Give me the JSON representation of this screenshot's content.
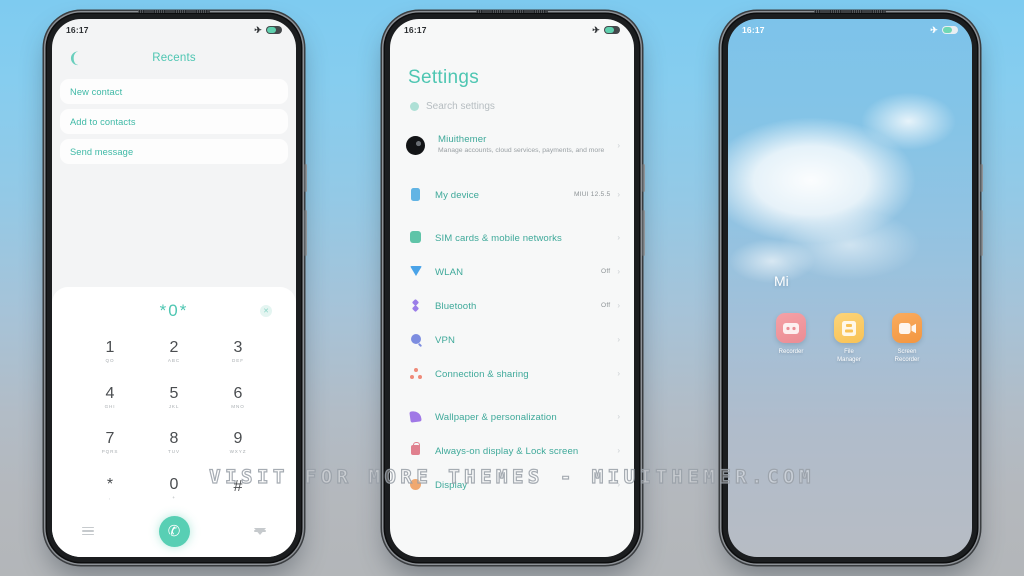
{
  "background": {
    "top_color": "#7ecbf0",
    "bottom_color": "#b3b6b9"
  },
  "watermark": {
    "text": "VISIT FOR MORE THEMES - MIUITHEMER.COM"
  },
  "accent_color": "#4ec6b2",
  "phone1": {
    "name": "dialer-phone",
    "status_bar": {
      "time": "16:17",
      "airplane_icon": "airplane-icon",
      "battery_icon": "battery-icon"
    },
    "header": {
      "back_icon": "back-chevron-icon",
      "title": "Recents"
    },
    "options": [
      {
        "label": "New contact"
      },
      {
        "label": "Add to contacts"
      },
      {
        "label": "Send message"
      }
    ],
    "dialpad": {
      "entry": "*0*",
      "clear_icon": "clear-backspace-icon",
      "keys": [
        {
          "digit": "1",
          "letters": "QO"
        },
        {
          "digit": "2",
          "letters": "ABC"
        },
        {
          "digit": "3",
          "letters": "DEF"
        },
        {
          "digit": "4",
          "letters": "GHI"
        },
        {
          "digit": "5",
          "letters": "JKL"
        },
        {
          "digit": "6",
          "letters": "MNO"
        },
        {
          "digit": "7",
          "letters": "PQRS"
        },
        {
          "digit": "8",
          "letters": "TUV"
        },
        {
          "digit": "9",
          "letters": "WXYZ"
        },
        {
          "digit": "*",
          "letters": ","
        },
        {
          "digit": "0",
          "letters": "+"
        },
        {
          "digit": "#",
          "letters": ""
        }
      ],
      "menu_icon": "hamburger-menu-icon",
      "call_icon": "phone-call-icon",
      "collapse_icon": "collapse-keypad-icon"
    }
  },
  "phone2": {
    "name": "settings-phone",
    "status_bar": {
      "time": "16:17",
      "airplane_icon": "airplane-icon",
      "battery_icon": "battery-icon"
    },
    "title": "Settings",
    "search": {
      "icon": "search-icon",
      "placeholder": "Search settings"
    },
    "account": {
      "avatar": "user-avatar",
      "name": "Miuithemer",
      "subtitle": "Manage accounts, cloud services, payments, and more",
      "chevron": "chevron-right-icon"
    },
    "items": [
      {
        "icon": "device-icon",
        "label": "My device",
        "value": "MIUI 12.5.5",
        "chevron": "chevron-right-icon"
      },
      {
        "icon": "sim-card-icon",
        "label": "SIM cards & mobile networks",
        "value": "",
        "chevron": "chevron-right-icon"
      },
      {
        "icon": "wifi-icon",
        "label": "WLAN",
        "value": "Off",
        "chevron": "chevron-right-icon"
      },
      {
        "icon": "bluetooth-icon",
        "label": "Bluetooth",
        "value": "Off",
        "chevron": "chevron-right-icon"
      },
      {
        "icon": "vpn-icon",
        "label": "VPN",
        "value": "",
        "chevron": "chevron-right-icon"
      },
      {
        "icon": "connection-icon",
        "label": "Connection & sharing",
        "value": "",
        "chevron": "chevron-right-icon"
      },
      {
        "icon": "wallpaper-icon",
        "label": "Wallpaper & personalization",
        "value": "",
        "chevron": "chevron-right-icon"
      },
      {
        "icon": "lock-icon",
        "label": "Always-on display & Lock screen",
        "value": "",
        "chevron": "chevron-right-icon"
      },
      {
        "icon": "display-icon",
        "label": "Display",
        "value": "",
        "chevron": "chevron-right-icon"
      }
    ]
  },
  "phone3": {
    "name": "home-screen-phone",
    "status_bar": {
      "time": "16:17",
      "airplane_icon": "airplane-icon",
      "battery_icon": "battery-icon"
    },
    "folder_label": "Mi",
    "apps": [
      {
        "icon": "recorder-icon",
        "label": "Recorder",
        "color": "#f0959c"
      },
      {
        "icon": "file-manager-icon",
        "label": "File Manager",
        "color": "#facb66"
      },
      {
        "icon": "screen-recorder-icon",
        "label": "Screen Recorder",
        "color": "#f6a04f"
      }
    ]
  }
}
